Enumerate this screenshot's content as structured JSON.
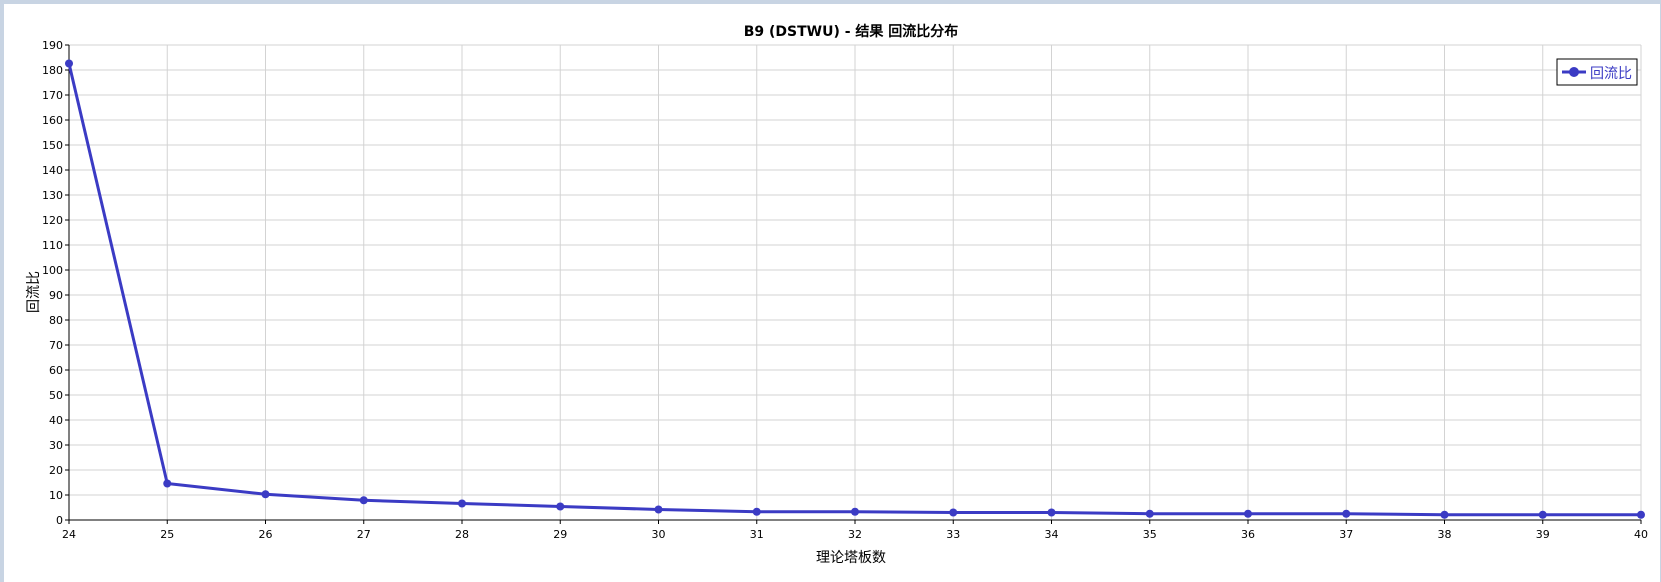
{
  "colors": {
    "series": "#3b3bc4",
    "grid": "#d3d3d3",
    "axis": "#000000",
    "frame": "#c8d4e3"
  },
  "chart_data": {
    "type": "line",
    "title": "B9 (DSTWU) - 结果 回流比分布",
    "xlabel": "理论塔板数",
    "ylabel": "回流比",
    "xlim": [
      24,
      40
    ],
    "ylim": [
      0,
      190
    ],
    "xticks": [
      24,
      25,
      26,
      27,
      28,
      29,
      30,
      31,
      32,
      33,
      34,
      35,
      36,
      37,
      38,
      39,
      40
    ],
    "yticks": [
      0,
      10,
      20,
      30,
      40,
      50,
      60,
      70,
      80,
      90,
      100,
      110,
      120,
      130,
      140,
      150,
      160,
      170,
      180,
      190
    ],
    "grid": true,
    "legend_position": "top-right",
    "series": [
      {
        "name": "回流比",
        "x": [
          24,
          25,
          26,
          27,
          28,
          29,
          30,
          31,
          32,
          33,
          34,
          35,
          36,
          37,
          38,
          39,
          40
        ],
        "y": [
          182.6,
          14.6,
          10.3,
          7.9,
          6.6,
          5.4,
          4.2,
          3.3,
          3.3,
          3.0,
          3.0,
          2.5,
          2.5,
          2.5,
          2.1,
          2.1,
          2.1
        ]
      }
    ]
  }
}
